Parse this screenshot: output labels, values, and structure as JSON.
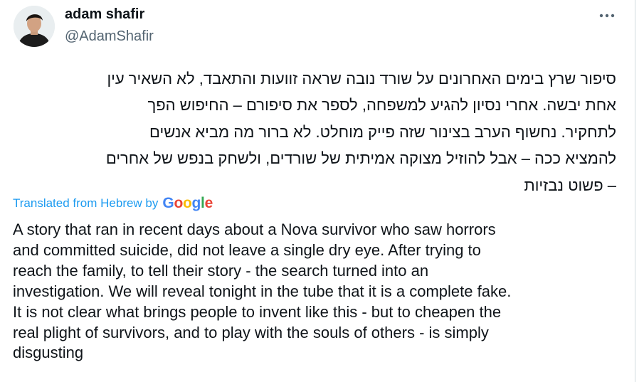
{
  "author": {
    "name": "adam shafir",
    "handle": "@AdamShafir"
  },
  "menu": {
    "icon": "more-horizontal-icon"
  },
  "hebrew_lines": [
    "סיפור שרץ בימים האחרונים על שורד נובה שראה זוועות והתאבד, לא השאיר עין",
    "אחת יבשה. אחרי נסיון להגיע למשפחה, לספר את סיפורם – החיפוש הפך",
    "לתחקיר. נחשוף הערב בצינור שזה פייק מוחלט. לא ברור מה מביא אנשים",
    "להמציא ככה – אבל להוזיל מצוקה אמיתית של שורדים, ולשחק בנפש של אחרים",
    "– פשוט נבזיות"
  ],
  "translation": {
    "label": "Translated from Hebrew by",
    "provider_letters": [
      "G",
      "o",
      "o",
      "g",
      "l",
      "e"
    ]
  },
  "english_lines": [
    "A story that ran in recent days about a Nova survivor who saw horrors",
    "and committed suicide, did not leave a single dry eye. After trying to",
    "reach the family, to tell their story - the search turned into an",
    "investigation. We will reveal tonight in the tube that it is a complete fake.",
    "It is not clear what brings people to invent like this - but to cheapen the",
    "real plight of survivors, and to play with the souls of others - is simply",
    "disgusting"
  ]
}
